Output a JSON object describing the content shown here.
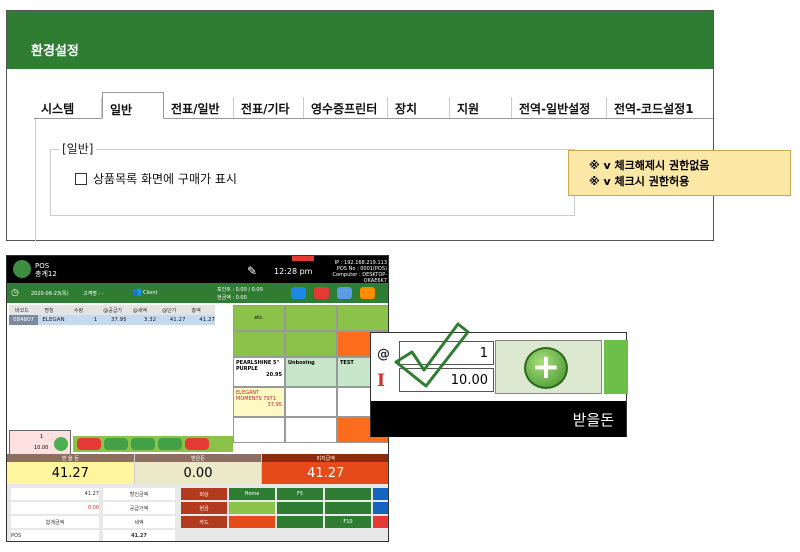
{
  "settings": {
    "title": "환경설정",
    "tabs": [
      "시스템",
      "일반",
      "전표/일반",
      "전표/기타",
      "영수증프린터",
      "장치",
      "지원",
      "전역-일반설정",
      "전역-코드설정1"
    ],
    "active_tab": "일반",
    "group_title": "[일반]",
    "checkbox_label": "상품목록 화면에 구매가 표시",
    "checkbox_checked": false,
    "note_line1": "※ v 체크해제시 권한없음",
    "note_line2": "※ v 체크시 권한허용"
  },
  "pos": {
    "app_name": "POS",
    "app_sub": "충계12",
    "time": "12:28 pm",
    "ip_line1": "IP : 192.168.219.113",
    "ip_line2": "POS No : 0001(POS)",
    "ip_line3": "Computer : DESKTOP-OKAE6K7",
    "date": "2020-08-23(목)",
    "customer_label": "고객명 : -",
    "client_label": "Client",
    "points1": "포인트 : 0.00 / 0.00",
    "points2": "현금액 : 0.00",
    "grid_headers": [
      "바코드",
      "명칭",
      "수량",
      "@공급가",
      "@세액",
      "@단가",
      "총액"
    ],
    "grid_row": [
      "084807",
      "ELEGAN",
      "1",
      "37.95",
      "3.32",
      "41.27",
      "41.27"
    ],
    "tiles": {
      "etc": "etc.",
      "page": "1 PAG",
      "pearl": "PEARLSHINE 5\" PURPLE",
      "pearl_price": "20.95",
      "unboxing": "Unboxing",
      "test": "TEST",
      "elegant": "ELEGANT MOMENTS 7971",
      "elegant_price": "37.95",
      "page2": "1 PAG"
    },
    "numpad_qty": "1",
    "numpad_amount": "10.00",
    "totals": [
      {
        "label": "받 을 돈",
        "value": "41.27"
      },
      {
        "label": "받은돈",
        "value": "0.00"
      },
      {
        "label": "미지급액",
        "value": "41.27"
      }
    ],
    "bottom": {
      "qty": "1",
      "qty_total": "41.27",
      "discount": "0",
      "discount_total": "0.00",
      "supply": "37.95",
      "tax": "3.32",
      "total": "41.27",
      "hold_label": "할인금액",
      "supply_label": "공급가액",
      "tax_label": "세액",
      "total_label": "합계금액",
      "cashier_label": "외상",
      "pos_label": "POS",
      "cash_label": "현금",
      "card_label": "카드",
      "home_label": "Home",
      "f5_label": "F5",
      "f10_label": "F10"
    }
  },
  "zoom": {
    "at_symbol": "@",
    "i_symbol": "I",
    "qty": "1",
    "amount": "10.00",
    "bottom_label": "받을돈"
  }
}
